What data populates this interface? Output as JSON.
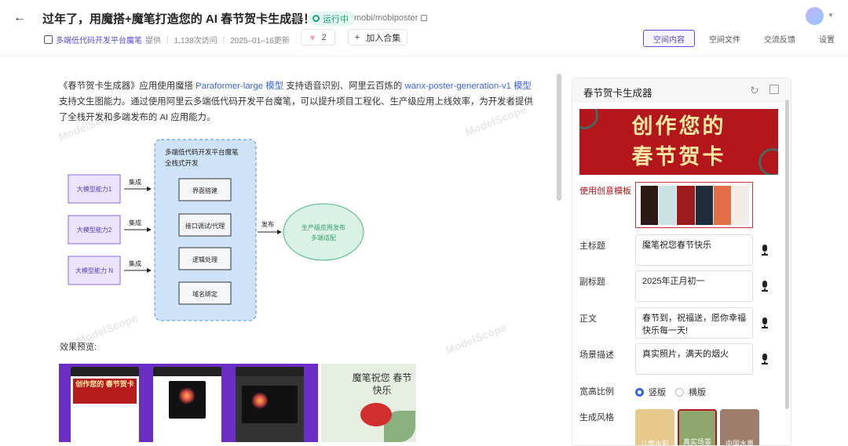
{
  "header": {
    "title": "过年了，用魔搭+魔笔打造您的 AI 春节贺卡生成器！",
    "status": "运行中",
    "repo": "mobi/mobiposter",
    "org_name": "多端低代码开发平台魔笔",
    "provided": "提供",
    "visits": "1,138次访问",
    "updated": "2025–01–16更新",
    "likes": "2",
    "collect_label": "加入合集",
    "tabs": [
      "空间内容",
      "空间文件",
      "交流反馈",
      "设置"
    ]
  },
  "intro": {
    "p1": "《春节贺卡生成器》应用使用魔搭 ",
    "link1": "Paraformer-large 模型",
    "p2": " 支持语音识别、阿里云百炼的 ",
    "link2": "wanx-poster-generation-v1 模型",
    "p3": " 支持文生图能力。通过使用阿里云多端低代码开发平台魔笔，可以提升项目工程化、生产级应用上线效率，为开发者提供了全栈开发和多端发布的 AI 应用能力。"
  },
  "diagram": {
    "platform_title": "多端低代码开发平台魔笔",
    "platform_sub": "全栈式开发",
    "models": [
      "大模型能力1",
      "大模型能力2",
      "大模型能力 N"
    ],
    "integrate": "集成",
    "steps": [
      "界面搭建",
      "接口调试/代理",
      "逻辑处理",
      "域名绑定"
    ],
    "publish": "发布",
    "output1": "生产级应用发布",
    "output2": "多端适配"
  },
  "preview": {
    "label": "效果预览:",
    "phone_banner": "创作您的 春节贺卡",
    "card_text": "魔笔祝您 春节快乐"
  },
  "watermark": "ModelScope",
  "panel": {
    "title": "春节贺卡生成器",
    "banner_line1": "创作您的",
    "banner_line2": "春节贺卡",
    "template_label": "使用创意模板",
    "fields": [
      {
        "label": "主标题",
        "value": "魔笔祝您春节快乐"
      },
      {
        "label": "副标题",
        "value": "2025年正月初一"
      },
      {
        "label": "正文",
        "value": "春节到，祝福送，愿你幸福快乐每一天!"
      },
      {
        "label": "场景描述",
        "value": "真实照片，满天的烟火"
      }
    ],
    "ratio_label": "宽高比例",
    "ratio_options": [
      "竖版",
      "横版"
    ],
    "style_label": "生成风格",
    "styles": [
      "儿童水彩",
      "真实场景",
      "中国水墨"
    ]
  },
  "colors": {
    "accent": "#5b4bd8",
    "link": "#3a62e8",
    "running": "#17a683",
    "festive_red": "#b3161b"
  }
}
